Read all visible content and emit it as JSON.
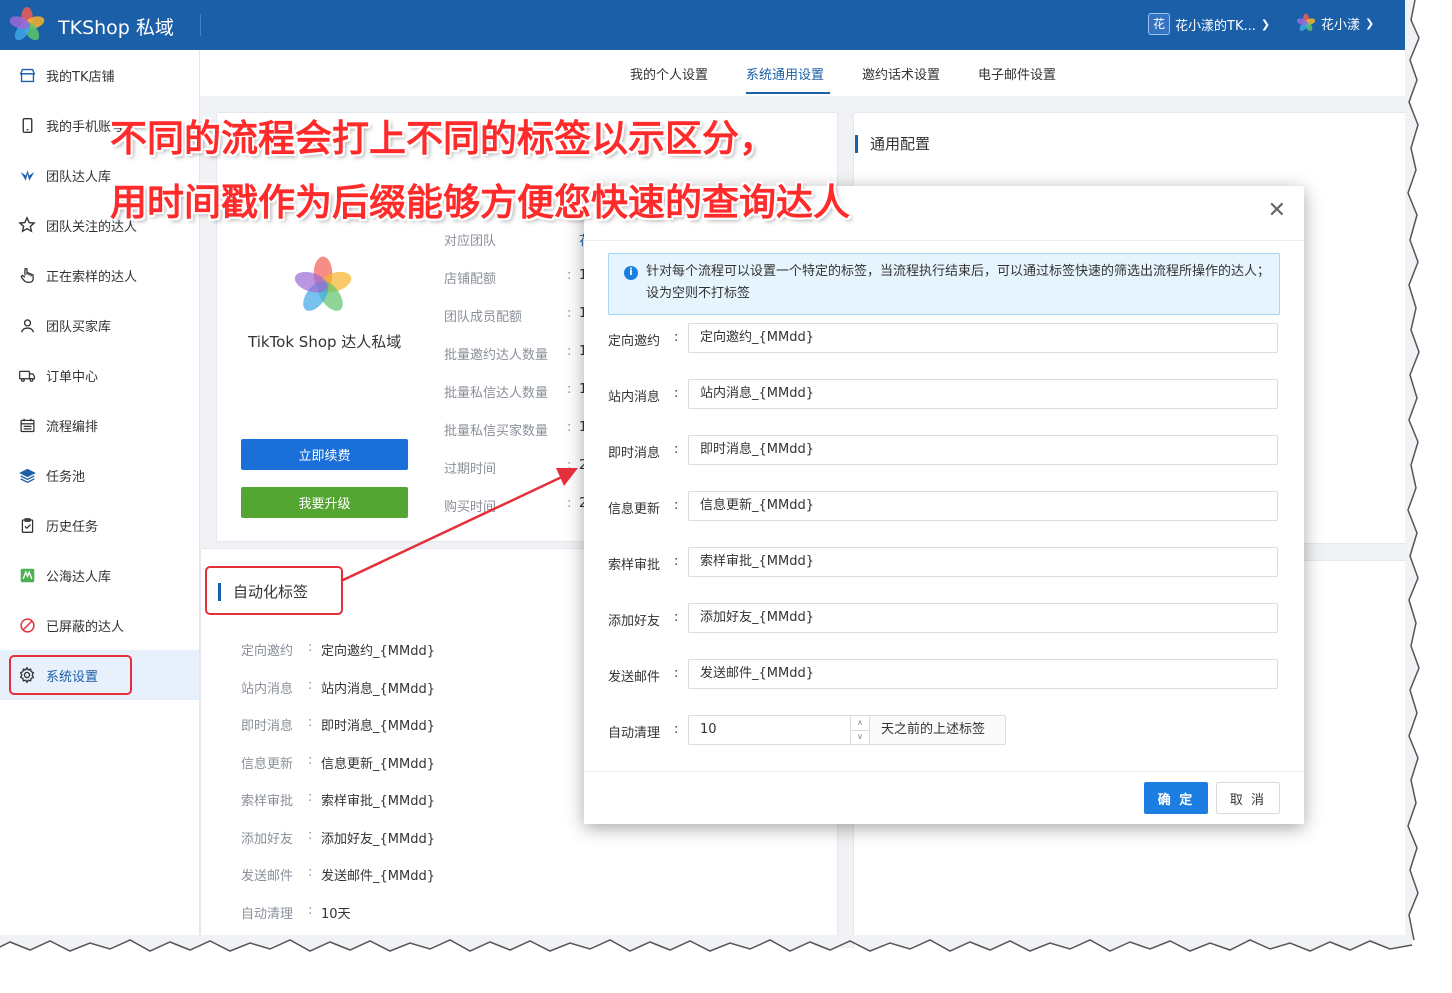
{
  "header": {
    "brand": "TKShop 私域",
    "account_badge": "花",
    "account_name": "花小漾的TK...",
    "user_name": "花小漾"
  },
  "sidebar": {
    "items": [
      {
        "label": "我的TK店铺",
        "icon": "shop-icon"
      },
      {
        "label": "我的手机账号",
        "icon": "phone-icon"
      },
      {
        "label": "团队达人库",
        "icon": "team-icon"
      },
      {
        "label": "团队关注的达人",
        "icon": "star-icon"
      },
      {
        "label": "正在索样的达人",
        "icon": "hand-icon"
      },
      {
        "label": "团队买家库",
        "icon": "user-icon"
      },
      {
        "label": "订单中心",
        "icon": "truck-icon"
      },
      {
        "label": "流程编排",
        "icon": "calendar-icon"
      },
      {
        "label": "任务池",
        "icon": "layers-icon"
      },
      {
        "label": "历史任务",
        "icon": "clipboard-icon"
      },
      {
        "label": "公海达人库",
        "icon": "sea-icon"
      },
      {
        "label": "已屏蔽的达人",
        "icon": "block-icon"
      },
      {
        "label": "系统设置",
        "icon": "gear-icon"
      }
    ],
    "active_index": 12
  },
  "tabs": [
    {
      "label": "我的个人设置"
    },
    {
      "label": "系统通用设置"
    },
    {
      "label": "邀约话术设置"
    },
    {
      "label": "电子邮件设置"
    }
  ],
  "active_tab": 1,
  "general": {
    "title": "通用配置"
  },
  "product": {
    "name": "TikTok Shop 达人私域",
    "renew_label": "立即续费",
    "upgrade_label": "我要升级",
    "info": [
      {
        "label": "对应团队",
        "value": "花"
      },
      {
        "label": "店铺配额",
        "value": "1"
      },
      {
        "label": "团队成员配额",
        "value": "1"
      },
      {
        "label": "批量邀约达人数量",
        "value": "1"
      },
      {
        "label": "批量私信达人数量",
        "value": "1"
      },
      {
        "label": "批量私信买家数量",
        "value": "1"
      },
      {
        "label": "过期时间",
        "value": "2"
      },
      {
        "label": "购买时间",
        "value": "2"
      }
    ]
  },
  "auto_tags": {
    "title": "自动化标签",
    "rows": [
      {
        "label": "定向邀约",
        "value": "定向邀约_{MMdd}"
      },
      {
        "label": "站内消息",
        "value": "站内消息_{MMdd}"
      },
      {
        "label": "即时消息",
        "value": "即时消息_{MMdd}"
      },
      {
        "label": "信息更新",
        "value": "信息更新_{MMdd}"
      },
      {
        "label": "索样审批",
        "value": "索样审批_{MMdd}"
      },
      {
        "label": "添加好友",
        "value": "添加好友_{MMdd}"
      },
      {
        "label": "发送邮件",
        "value": "发送邮件_{MMdd}"
      },
      {
        "label": "自动清理",
        "value": "10天"
      }
    ]
  },
  "caption": {
    "line1": "不同的流程会打上不同的标签以示区分，",
    "line2": "用时间戳作为后缀能够方便您快速的查询达人"
  },
  "modal": {
    "alert": "针对每个流程可以设置一个特定的标签，当流程执行结束后，可以通过标签快速的筛选出流程所操作的达人；设为空则不打标签",
    "fields": [
      {
        "label": "定向邀约",
        "value": "定向邀约_{MMdd}"
      },
      {
        "label": "站内消息",
        "value": "站内消息_{MMdd}"
      },
      {
        "label": "即时消息",
        "value": "即时消息_{MMdd}"
      },
      {
        "label": "信息更新",
        "value": "信息更新_{MMdd}"
      },
      {
        "label": "索样审批",
        "value": "索样审批_{MMdd}"
      },
      {
        "label": "添加好友",
        "value": "添加好友_{MMdd}"
      },
      {
        "label": "发送邮件",
        "value": "发送邮件_{MMdd}"
      }
    ],
    "cleanup_label": "自动清理",
    "cleanup_value": "10",
    "cleanup_suffix": "天之前的上述标签",
    "ok_label": "确 定",
    "cancel_label": "取 消"
  },
  "colors": {
    "primary": "#1b5fa8",
    "button_blue": "#1b6fd8",
    "button_green": "#55a532",
    "highlight_red": "#e5303b"
  }
}
